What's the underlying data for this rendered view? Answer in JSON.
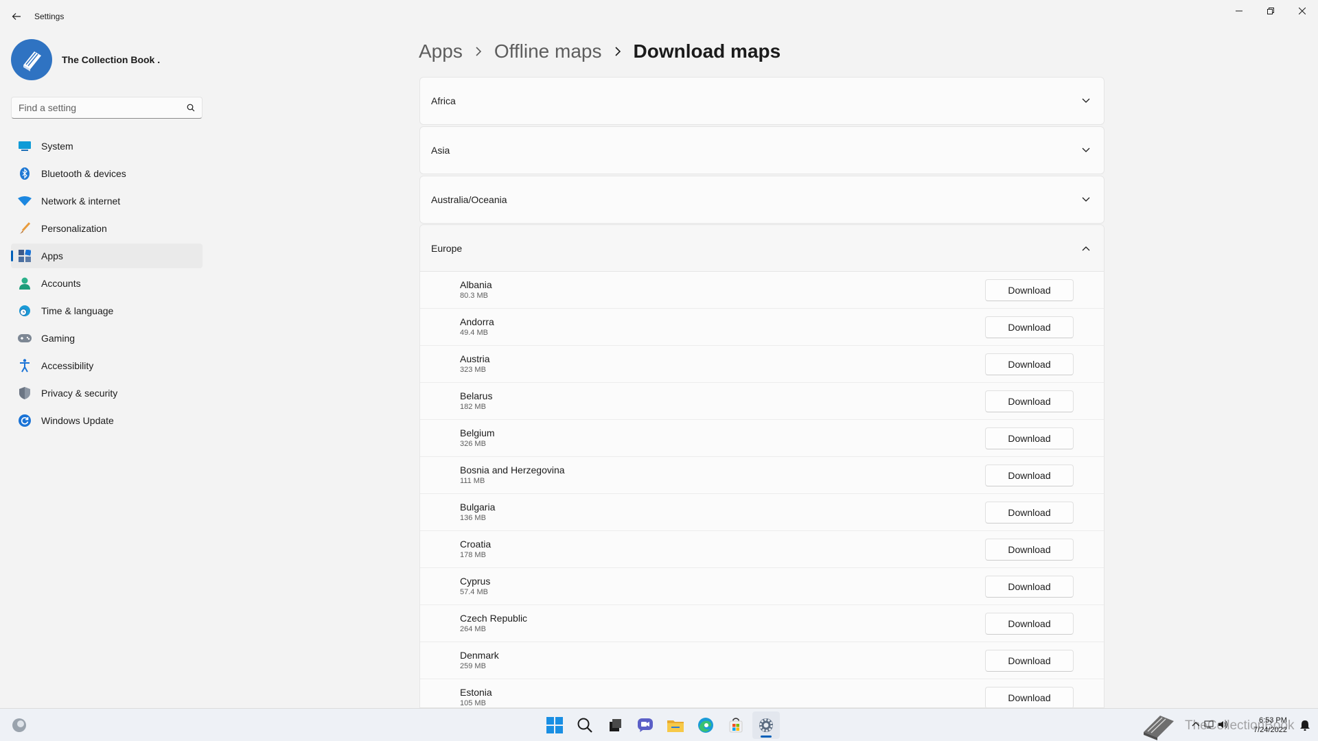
{
  "window": {
    "title": "Settings"
  },
  "profile": {
    "name": "The Collection Book ."
  },
  "search": {
    "placeholder": "Find a setting"
  },
  "sidebar": {
    "items": [
      {
        "label": "System",
        "icon": "system-icon"
      },
      {
        "label": "Bluetooth & devices",
        "icon": "bluetooth-icon"
      },
      {
        "label": "Network & internet",
        "icon": "wifi-icon"
      },
      {
        "label": "Personalization",
        "icon": "brush-icon"
      },
      {
        "label": "Apps",
        "icon": "apps-icon",
        "active": true
      },
      {
        "label": "Accounts",
        "icon": "person-icon"
      },
      {
        "label": "Time & language",
        "icon": "clock-globe-icon"
      },
      {
        "label": "Gaming",
        "icon": "gamepad-icon"
      },
      {
        "label": "Accessibility",
        "icon": "accessibility-icon"
      },
      {
        "label": "Privacy & security",
        "icon": "shield-icon"
      },
      {
        "label": "Windows Update",
        "icon": "update-icon"
      }
    ]
  },
  "breadcrumb": {
    "items": [
      "Apps",
      "Offline maps"
    ],
    "current": "Download maps"
  },
  "regions": {
    "collapsed": [
      "Africa",
      "Asia",
      "Australia/Oceania"
    ],
    "expanded": "Europe"
  },
  "download_label": "Download",
  "countries": [
    {
      "name": "Albania",
      "size": "80.3 MB"
    },
    {
      "name": "Andorra",
      "size": "49.4 MB"
    },
    {
      "name": "Austria",
      "size": "323 MB"
    },
    {
      "name": "Belarus",
      "size": "182 MB"
    },
    {
      "name": "Belgium",
      "size": "326 MB"
    },
    {
      "name": "Bosnia and Herzegovina",
      "size": "111 MB"
    },
    {
      "name": "Bulgaria",
      "size": "136 MB"
    },
    {
      "name": "Croatia",
      "size": "178 MB"
    },
    {
      "name": "Cyprus",
      "size": "57.4 MB"
    },
    {
      "name": "Czech Republic",
      "size": "264 MB"
    },
    {
      "name": "Denmark",
      "size": "259 MB"
    },
    {
      "name": "Estonia",
      "size": "105 MB"
    }
  ],
  "taskbar": {
    "apps": [
      "start-icon",
      "search-icon",
      "task-view-icon",
      "chat-icon",
      "file-explorer-icon",
      "edge-icon",
      "store-icon",
      "settings-icon"
    ],
    "watermark": "TheCollectionBook",
    "time": "6:53 PM",
    "date": "7/24/2022"
  },
  "colors": {
    "accent": "#005fb8",
    "background": "#f3f3f3",
    "card": "#fbfbfb"
  }
}
